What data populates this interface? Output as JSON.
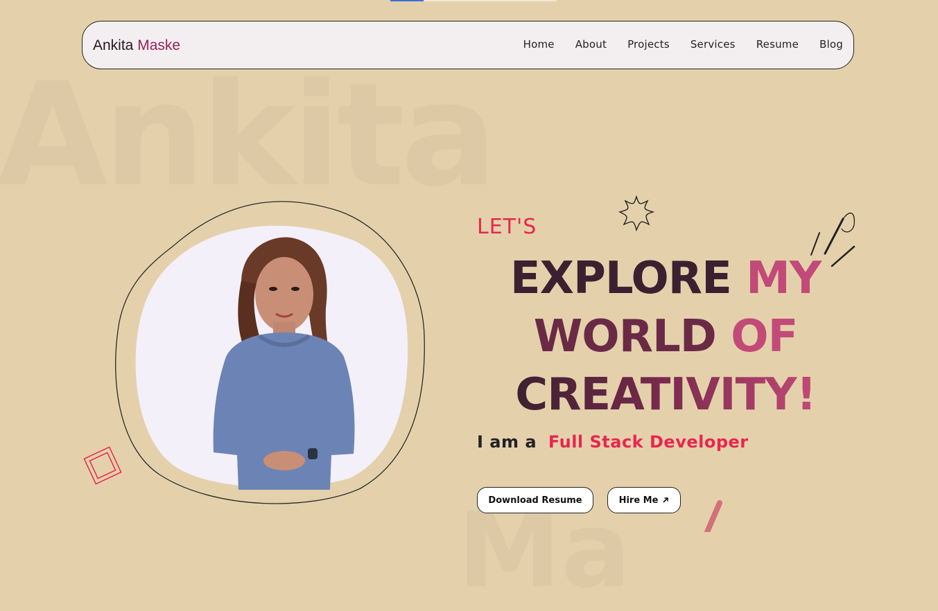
{
  "background_text": "Ankita",
  "background_text_2": "Ma",
  "brand": {
    "first": "Ankita",
    "last": "Maske"
  },
  "nav": {
    "items": [
      {
        "label": "Home"
      },
      {
        "label": "About"
      },
      {
        "label": "Projects"
      },
      {
        "label": "Services"
      },
      {
        "label": "Resume"
      },
      {
        "label": "Blog"
      }
    ]
  },
  "hero": {
    "kicker": "LET'S",
    "headline": {
      "line1_a": "EXPLORE ",
      "line1_b": "MY",
      "line2_a": "WORLD ",
      "line2_b": "OF",
      "line3_a": "CREATIVITY!"
    },
    "role_prefix": "I am a",
    "role_title": "Full Stack Developer",
    "buttons": {
      "download_resume": "Download Resume",
      "hire_me": "Hire Me",
      "hire_icon": "arrow-up-right-icon"
    }
  },
  "colors": {
    "background": "#e4d1ab",
    "accent": "#e8264f",
    "navbar_bg": "#f3eff0",
    "headline_dark": "#3b2130",
    "headline_pink": "#c24a78"
  }
}
